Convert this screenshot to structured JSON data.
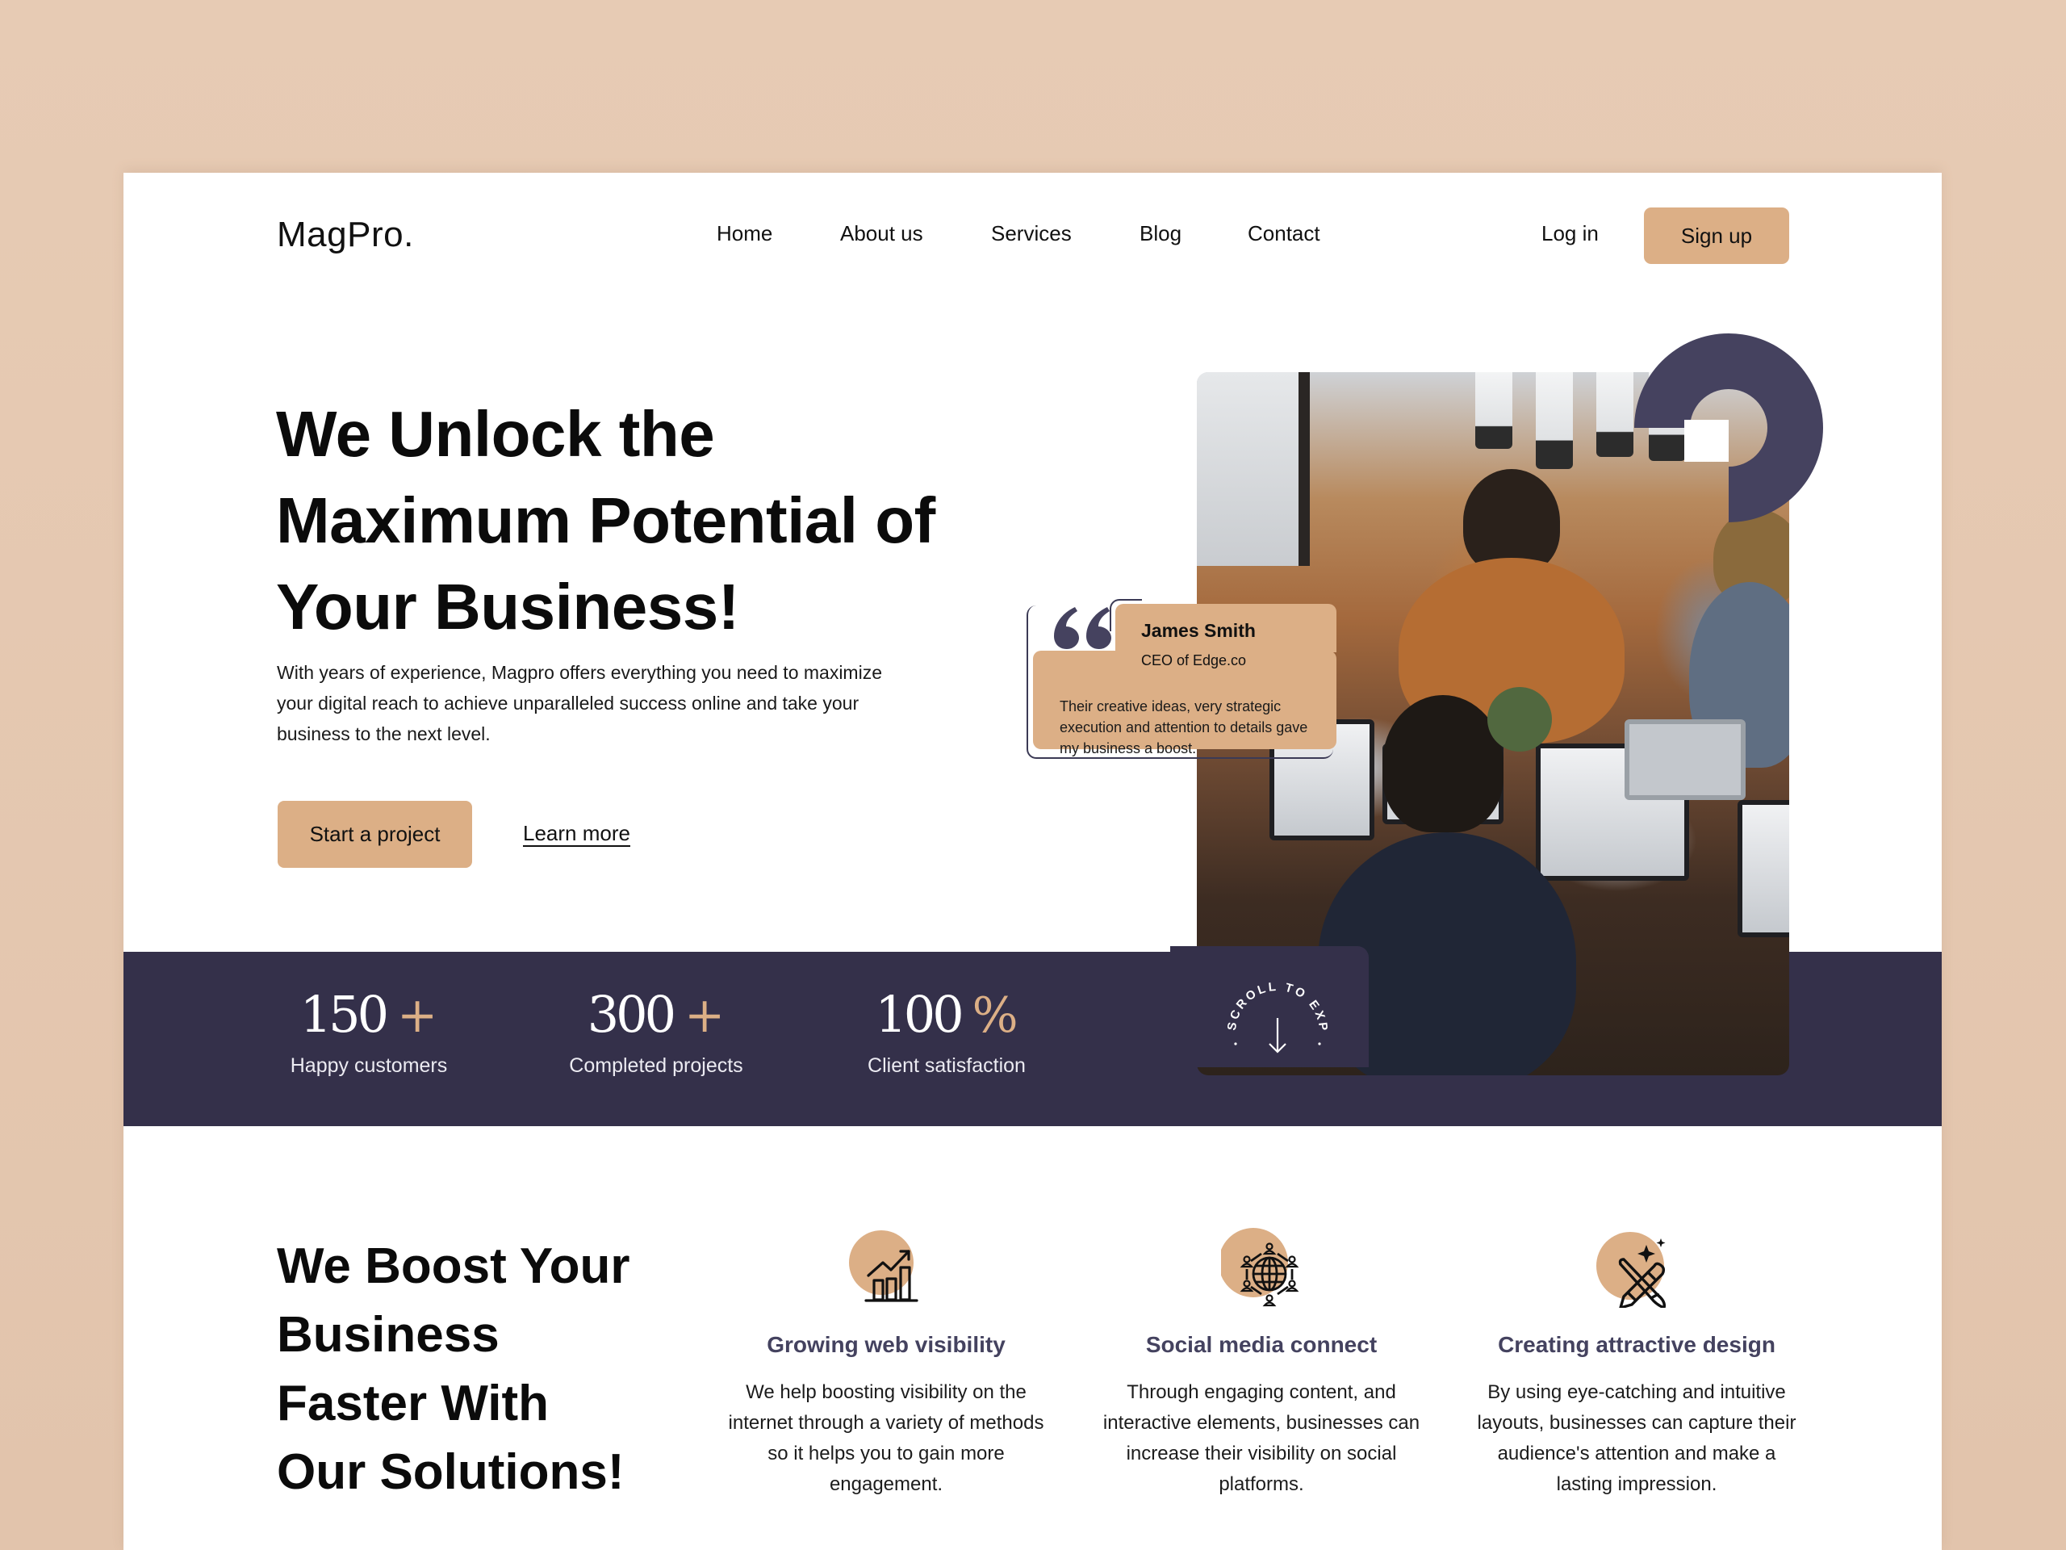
{
  "brand": {
    "logo": "MagPro.",
    "accent_color": "#dcaf86",
    "dark_color": "#34304a",
    "heading_color": "#44425f"
  },
  "nav": {
    "items": [
      {
        "label": "Home"
      },
      {
        "label": "About us"
      },
      {
        "label": "Services"
      },
      {
        "label": "Blog"
      },
      {
        "label": "Contact"
      }
    ],
    "login_label": "Log in",
    "signup_label": "Sign up"
  },
  "hero": {
    "title_lines": [
      "We Unlock the",
      "Maximum Potential of",
      "Your Business!"
    ],
    "description": "With years of experience, Magpro offers everything you need to maximize your digital reach to achieve unparalleled success online and take your business to the next level.",
    "primary_cta": "Start a project",
    "secondary_cta": "Learn more"
  },
  "testimonial": {
    "name": "James Smith",
    "role": "CEO of Edge.co",
    "quote": "Their creative ideas, very strategic execution and attention to details gave my business a boost.",
    "quote_icon": "quote-mark-icon"
  },
  "stats": [
    {
      "value": "150",
      "suffix": "+",
      "label": "Happy customers"
    },
    {
      "value": "300",
      "suffix": "+",
      "label": "Completed projects"
    },
    {
      "value": "100",
      "suffix": "%",
      "label": "Client satisfaction"
    }
  ],
  "scroll_badge": {
    "text": "SCROLL TO EXPLORE",
    "icon": "arrow-down-icon"
  },
  "services": {
    "title_lines": [
      "We Boost Your",
      "Business",
      "Faster With",
      "Our Solutions!"
    ],
    "items": [
      {
        "icon": "growth-chart-icon",
        "title": "Growing web visibility",
        "description": "We help boosting visibility on the internet through a variety of methods so it helps you to gain more engagement."
      },
      {
        "icon": "social-network-globe-icon",
        "title": "Social media connect",
        "description": "Through engaging content, and interactive elements, businesses can increase their visibility on social platforms."
      },
      {
        "icon": "design-tools-icon",
        "title": "Creating attractive design",
        "description": "By using eye-catching and intuitive layouts, businesses can capture their audience's attention and make a lasting impression."
      }
    ]
  }
}
